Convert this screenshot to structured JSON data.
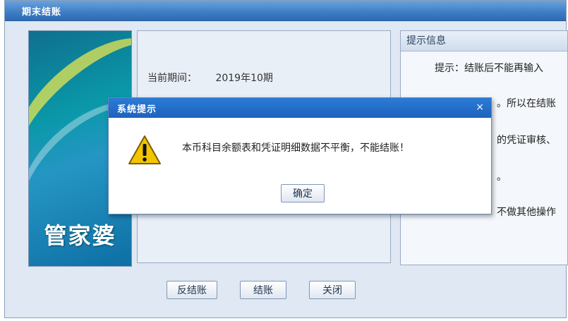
{
  "window": {
    "title": "期末结账"
  },
  "banner": {
    "brand": "管家婆"
  },
  "period": {
    "label": "当前期间：",
    "value": "2019年10期"
  },
  "tips": {
    "header": "提示信息",
    "lines": [
      "提示：结账后不能再输入",
      "。所以在结账",
      "的凭证审核、",
      "。",
      "不做其他操作"
    ]
  },
  "buttons": {
    "unclose": "反结账",
    "close_period": "结账",
    "exit": "关闭"
  },
  "dialog": {
    "title": "系统提示",
    "close_glyph": "×",
    "message": "本币科目余额表和凭证明细数据不平衡，不能结账！",
    "ok": "确定",
    "icon": "warning-icon",
    "icon_color": "#f2c500"
  }
}
